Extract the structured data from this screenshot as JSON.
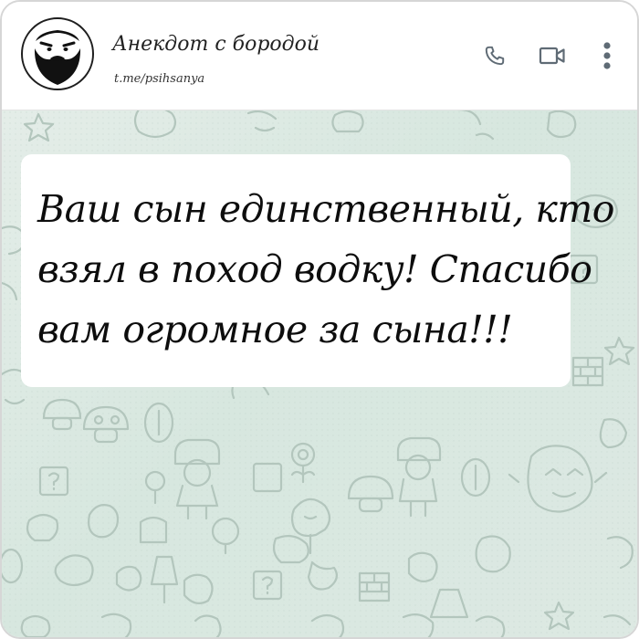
{
  "header": {
    "title": "Анекдот с бородой",
    "subtitle": "t.me/psihsanya",
    "avatar_icon": "bearded-man-icon",
    "actions": [
      {
        "name": "call",
        "icon": "phone-icon"
      },
      {
        "name": "video",
        "icon": "video-camera-icon"
      },
      {
        "name": "more",
        "icon": "more-vertical-icon"
      }
    ]
  },
  "message": {
    "lines": [
      "Ваш сын единственный, кто",
      "взял в поход водку! Спасибо",
      "вам огромное за сына!!!"
    ]
  },
  "colors": {
    "header_bg": "#ffffff",
    "chat_bg": "#d7e7df",
    "doodle": "#b8c9c1",
    "icon": "#5f6b75",
    "bubble": "#ffffff",
    "text": "#0d0d0d"
  }
}
